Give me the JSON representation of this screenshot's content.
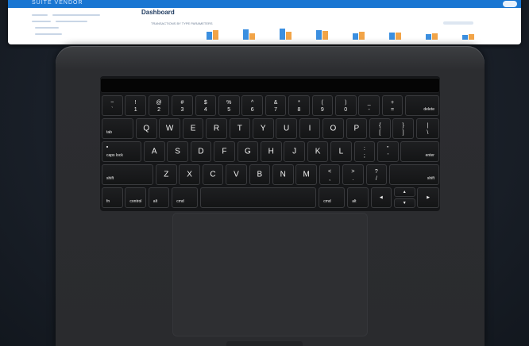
{
  "screen": {
    "brand": "SUITE VENDOR",
    "page_title": "Dashboard",
    "chart_caption": "TRANSACTIONS BY TYPE PARAMETERS",
    "chart_colors": {
      "series_a": "#3b8fe0",
      "series_b": "#f2a447"
    },
    "bars_a": [
      0.55,
      0.7,
      0.8,
      0.65,
      0.45,
      0.5,
      0.4,
      0.35
    ],
    "bars_b": [
      0.65,
      0.45,
      0.55,
      0.6,
      0.55,
      0.5,
      0.45,
      0.4
    ]
  },
  "keyboard": {
    "row1": [
      {
        "top": "~",
        "bot": "`"
      },
      {
        "top": "!",
        "bot": "1"
      },
      {
        "top": "@",
        "bot": "2"
      },
      {
        "top": "#",
        "bot": "3"
      },
      {
        "top": "$",
        "bot": "4"
      },
      {
        "top": "%",
        "bot": "5"
      },
      {
        "top": "^",
        "bot": "6"
      },
      {
        "top": "&",
        "bot": "7"
      },
      {
        "top": "*",
        "bot": "8"
      },
      {
        "top": "(",
        "bot": "9"
      },
      {
        "top": ")",
        "bot": "0"
      },
      {
        "top": "_",
        "bot": "-"
      },
      {
        "top": "+",
        "bot": "="
      }
    ],
    "delete": "delete",
    "tab": "tab",
    "row2": [
      "Q",
      "W",
      "E",
      "R",
      "T",
      "Y",
      "U",
      "I",
      "O",
      "P"
    ],
    "row2_sym": [
      {
        "top": "{",
        "bot": "["
      },
      {
        "top": "}",
        "bot": "]"
      },
      {
        "top": "|",
        "bot": "\\"
      }
    ],
    "caps": "caps lock",
    "row3": [
      "A",
      "S",
      "D",
      "F",
      "G",
      "H",
      "J",
      "K",
      "L"
    ],
    "row3_sym": [
      {
        "top": ":",
        "bot": ";"
      },
      {
        "top": "\"",
        "bot": "'"
      }
    ],
    "enter": "enter",
    "shift_left": "shift",
    "row4": [
      "Z",
      "X",
      "C",
      "V",
      "B",
      "N",
      "M"
    ],
    "row4_sym": [
      {
        "top": "<",
        "bot": ","
      },
      {
        "top": ">",
        "bot": "."
      },
      {
        "top": "?",
        "bot": "/"
      }
    ],
    "shift_right": "shift",
    "fn": "fn",
    "control": "control",
    "alt_left": "alt",
    "cmd_left": "cmd",
    "cmd_right": "cmd",
    "alt_right": "alt",
    "arrow_left": "◀",
    "arrow_up": "▲",
    "arrow_down": "▼",
    "arrow_right": "▶"
  }
}
